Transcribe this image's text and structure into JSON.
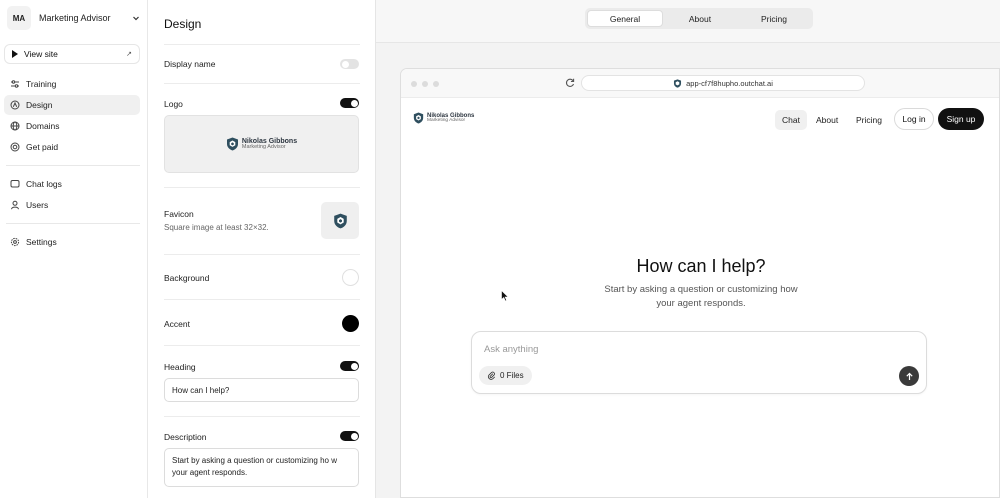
{
  "sidebar": {
    "workspace": {
      "initials": "MA",
      "name": "Marketing Advisor"
    },
    "view_site": "View site",
    "items": [
      {
        "label": "Training"
      },
      {
        "label": "Design"
      },
      {
        "label": "Domains"
      },
      {
        "label": "Get paid"
      },
      {
        "label": "Chat logs"
      },
      {
        "label": "Users"
      },
      {
        "label": "Settings"
      }
    ],
    "active_item": "Design"
  },
  "design": {
    "title": "Design",
    "display_name": {
      "label": "Display name",
      "enabled": false
    },
    "logo": {
      "label": "Logo",
      "enabled": true,
      "brand_name": "Nikolas Gibbons",
      "brand_sub": "Marketing Advisor"
    },
    "favicon": {
      "label": "Favicon",
      "hint": "Square image at least 32×32."
    },
    "background": {
      "label": "Background",
      "color": "#ffffff"
    },
    "accent": {
      "label": "Accent",
      "color": "#000000"
    },
    "heading": {
      "label": "Heading",
      "enabled": true,
      "value": "How can I help?"
    },
    "description": {
      "label": "Description",
      "enabled": true,
      "value": "Start by asking a question or customizing ho w your agent responds."
    }
  },
  "preview_tabs": [
    "General",
    "About",
    "Pricing"
  ],
  "preview_active_tab": "General",
  "browser": {
    "url": "app-cf7f8hupho.outchat.ai"
  },
  "site": {
    "brand_name": "Nikolas Gibbons",
    "brand_sub": "Marketing Advisor",
    "nav": [
      "Chat",
      "About",
      "Pricing"
    ],
    "nav_active": "Chat",
    "login": "Log in",
    "signup": "Sign up",
    "heading": "How can I help?",
    "description": "Start by asking a question or customizing how your agent responds.",
    "input_placeholder": "Ask anything",
    "files_label": "0 Files"
  },
  "colors": {
    "brand_shield": "#2f4f5f",
    "primary": "#111111"
  }
}
